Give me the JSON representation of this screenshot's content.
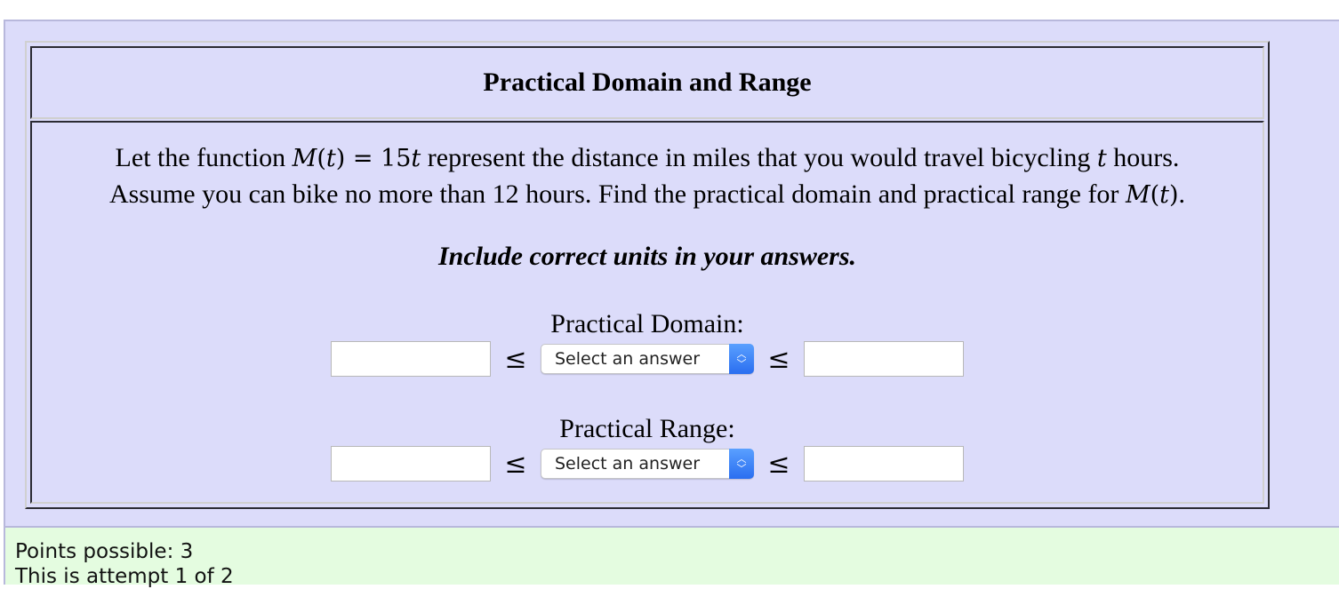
{
  "question": {
    "title": "Practical Domain and Range",
    "problem": {
      "line1_pre": "Let the function ",
      "func_name": "M",
      "func_var": "t",
      "equals": " = ",
      "coef": "15",
      "var": "t",
      "line1_mid": " represent the distance in miles that you would travel bicycling ",
      "line1_var": "t",
      "line1_post": " hours.",
      "line2_pre": "Assume you can bike no more than 12 hours. Find the practical domain and practical range for ",
      "line2_func": "M",
      "line2_var": "t",
      "line2_post": "."
    },
    "instruction": "Include correct units in your answers.",
    "domain": {
      "label": "Practical Domain:",
      "lower_value": "",
      "upper_value": "",
      "relation": "≤",
      "select_value": "Select an answer"
    },
    "range": {
      "label": "Practical Range:",
      "lower_value": "",
      "upper_value": "",
      "relation": "≤",
      "select_value": "Select an answer"
    }
  },
  "footer": {
    "points": "Points possible: 3",
    "attempt": "This is attempt 1 of 2"
  },
  "colors": {
    "question_bg": "#dcdcfa",
    "footer_bg": "#e4fce0",
    "select_accent": "#2a6ef0"
  }
}
